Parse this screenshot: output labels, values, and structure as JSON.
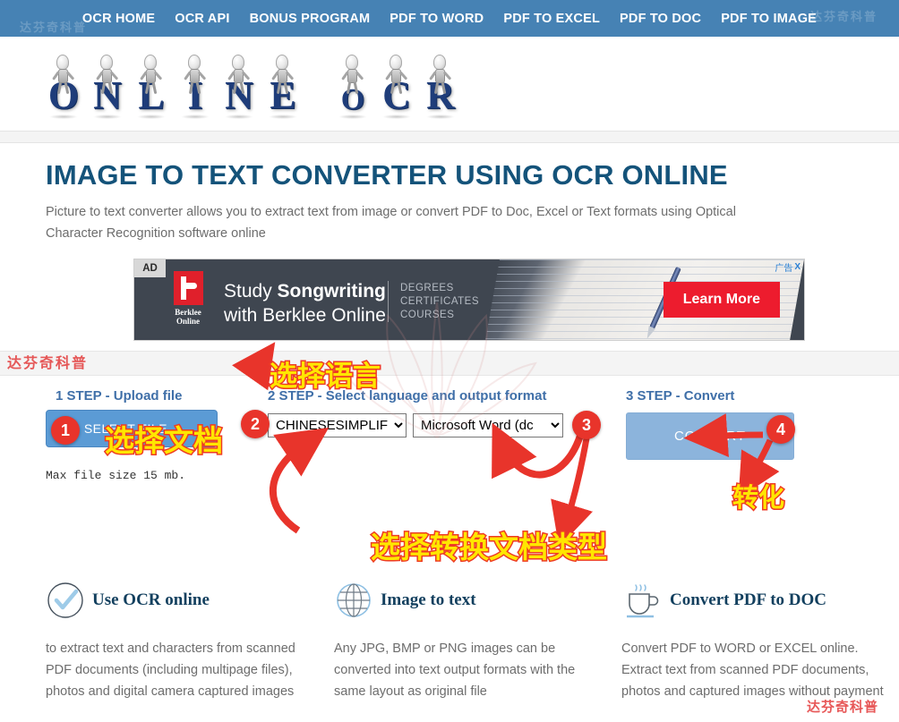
{
  "nav": {
    "items": [
      {
        "label": "OCR HOME",
        "name": "nav-ocr-home"
      },
      {
        "label": "OCR API",
        "name": "nav-ocr-api"
      },
      {
        "label": "BONUS PROGRAM",
        "name": "nav-bonus-program"
      },
      {
        "label": "PDF TO WORD",
        "name": "nav-pdf-to-word"
      },
      {
        "label": "PDF TO EXCEL",
        "name": "nav-pdf-to-excel"
      },
      {
        "label": "PDF TO DOC",
        "name": "nav-pdf-to-doc"
      },
      {
        "label": "PDF TO IMAGE",
        "name": "nav-pdf-to-image"
      }
    ],
    "watermark": "达芬奇科普"
  },
  "logo": {
    "word1": "ONLINE",
    "word2": "OCR",
    "alt": "online-ocr-logo"
  },
  "hero": {
    "title": "IMAGE TO TEXT CONVERTER USING OCR ONLINE",
    "subtitle": "Picture to text converter allows you to extract text from image or convert PDF to Doc, Excel or Text formats using Optical Character Recognition software online"
  },
  "ad": {
    "badge": "AD",
    "brand_line1": "Berklee",
    "brand_line2": "Online",
    "headline_line1_plain": "Study ",
    "headline_line1_bold": "Songwriting",
    "headline_line2": "with Berklee Online",
    "list": "DEGREES\nCERTIFICATES\nCOURSES",
    "cta": "Learn More",
    "choices": "广告",
    "close": "X"
  },
  "steps": {
    "step1_label": "1 STEP - Upload file",
    "step2_label": "2 STEP - Select language and output format",
    "step3_label": "3 STEP - Convert",
    "select_file_button": "SELECT FILE...",
    "max_file_size": "Max file size 15 mb.",
    "language_value": "CHINESESIMPLIFII",
    "format_value": "Microsoft Word (dc",
    "convert_button": "CONVERT"
  },
  "annotations": {
    "marker1": "1",
    "marker2": "2",
    "marker3": "3",
    "marker4": "4",
    "select_file_cn": "选择文档",
    "select_language_cn": "选择语言",
    "select_type_cn": "选择转换文档类型",
    "convert_cn": "转化",
    "watermark_red": "达芬奇科普"
  },
  "features": [
    {
      "icon": "check-circle-icon",
      "title": "Use OCR online",
      "text": "to extract text and characters from scanned PDF documents (including multipage files), photos and digital camera captured images"
    },
    {
      "icon": "globe-icon",
      "title": "Image to text",
      "text": "Any JPG, BMP or PNG images can be converted into text output formats with the same layout as original file"
    },
    {
      "icon": "coffee-cup-icon",
      "title": "Convert PDF to DOC",
      "text": "Convert PDF to WORD or EXCEL online. Extract text from scanned PDF documents, photos and captured images without payment"
    }
  ],
  "colors": {
    "nav_blue": "#4682b4",
    "heading_blue": "#14537a",
    "step_blue": "#3f6fa8",
    "button_blue": "#5b9bd5",
    "convert_blue": "#8cb4dc",
    "marker_red": "#e8342b",
    "annotation_yellow": "#ffe600",
    "annotation_stroke": "#ee3b24",
    "ad_red": "#ed1c2e",
    "ad_bg": "#3f4650"
  }
}
